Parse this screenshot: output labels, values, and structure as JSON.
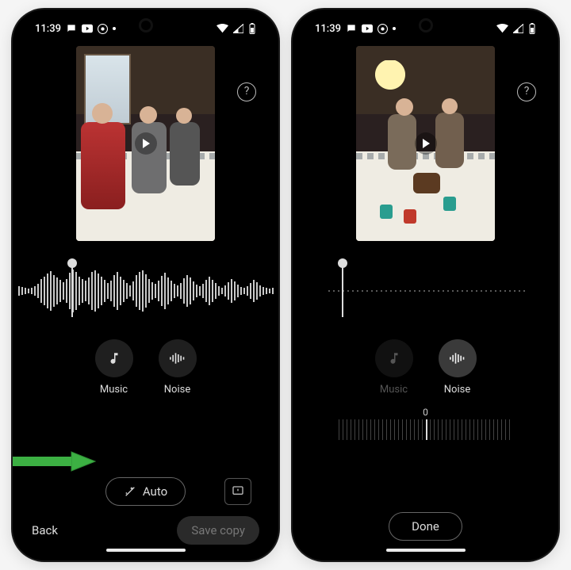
{
  "status": {
    "time": "11:39",
    "icons": [
      "chat-bubble-icon",
      "youtube-icon",
      "chrome-icon",
      "dot"
    ]
  },
  "help": {
    "symbol": "?"
  },
  "chips": {
    "music": {
      "label": "Music"
    },
    "noise": {
      "label": "Noise"
    }
  },
  "auto_button": {
    "label": "Auto"
  },
  "footer": {
    "back": "Back",
    "save": "Save copy",
    "done": "Done"
  },
  "slider": {
    "value_label": "0"
  }
}
